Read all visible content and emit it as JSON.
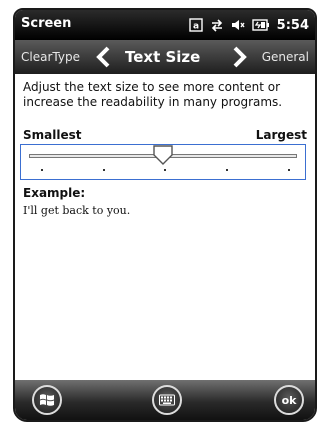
{
  "status_bar": {
    "title": "Screen",
    "time": "5:54",
    "icons": [
      "keyboard-mode-icon",
      "sync-arrows-icon",
      "volume-icon",
      "battery-icon"
    ]
  },
  "nav": {
    "prev_label": "ClearType",
    "title": "Text Size",
    "next_label": "General"
  },
  "content": {
    "description": "Adjust the text size to see more content or increase the readability in many programs.",
    "smallest_label": "Smallest",
    "largest_label": "Largest",
    "slider": {
      "positions": 5,
      "selected_index": 2
    },
    "example_label": "Example:",
    "example_text": "I'll get back to you."
  },
  "softkeys": {
    "start": "windows-start-icon",
    "keyboard": "keyboard-icon",
    "ok_label": "ok"
  },
  "colors": {
    "slider_border": "#3b6fd1",
    "status_bar": "#000000",
    "nav_bar": "#3a3a3a"
  }
}
